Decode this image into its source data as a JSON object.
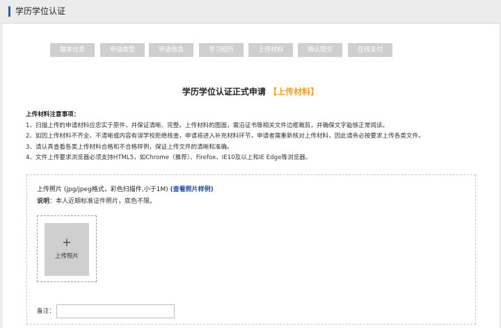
{
  "header": {
    "title": "学历学位认证"
  },
  "steps": [
    "基本信息",
    "申请类型",
    "申请信息",
    "学习经历",
    "上传材料",
    "确认提交",
    "在线支付"
  ],
  "heading": {
    "text": "学历学位认证正式申请",
    "tag": "【上传材料】"
  },
  "notes": {
    "title": "上传材料注意事项：",
    "items": [
      "1、扫描上传的申请材料应忠实于原件，并保证清晰、完整。上传材料的图面，需沿证书等相关文件边框裁剪，并确保文字能够正常阅读。",
      "2、如因上传材料不齐全、不清晰或内容有误学校拒绝核查，申请将进入补充材料环节，申请者需重新核对上传材料，因此请务必按要求上传各类文件。",
      "3、请认真查看各类上传材料合格和不合格样例，保证上传文件的清晰和准确。",
      "4、文件上传要求浏览器必须支持HTML5，如Chrome（推荐）、Firefox、IE10及以上和IE Edge等浏览器。"
    ]
  },
  "upload": {
    "title": "上传照片 (jpg/jpeg格式，彩色扫描件,小于1M)",
    "sample_link": "(查看照片样例)",
    "desc_label": "说明",
    "desc_text": "：本人近期标准证件照片，底色不限。",
    "plus": "+",
    "button_label": "上传照片",
    "remark_label": "备注：",
    "remark_value": ""
  }
}
